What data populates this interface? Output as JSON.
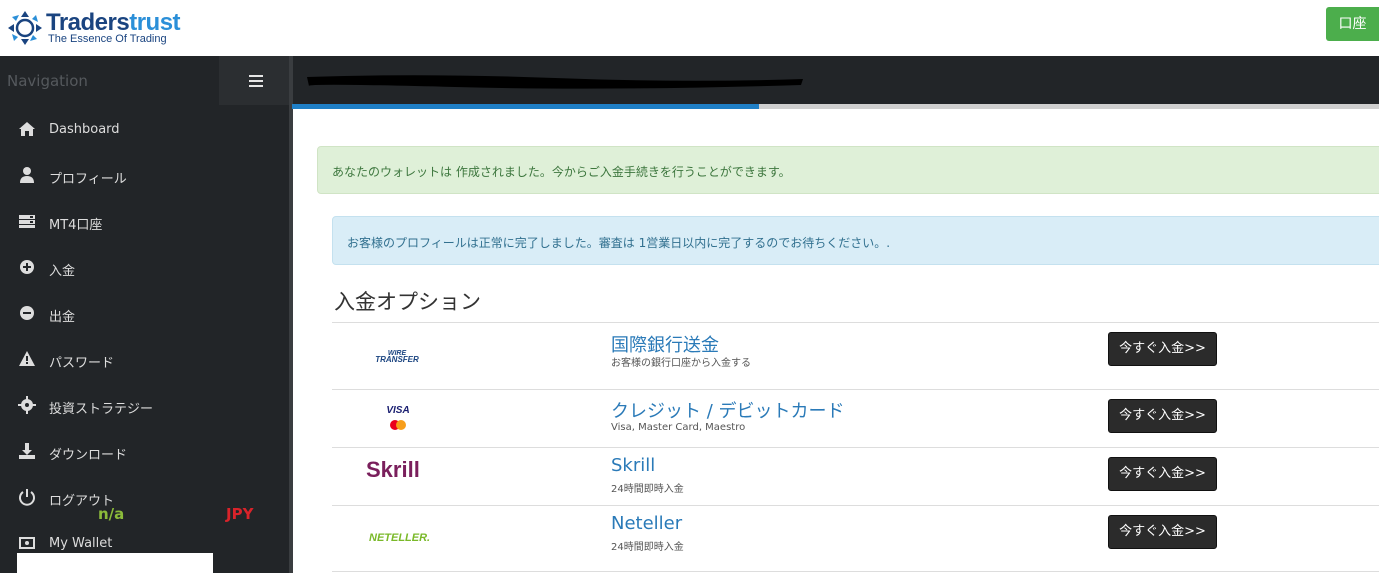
{
  "header": {
    "brand_name_part1": "Traders",
    "brand_name_part2": "trust",
    "tagline": "The Essence Of Trading",
    "account_button": "口座",
    "account_button_color": "#4cae4c"
  },
  "sidebar": {
    "title": "Navigation",
    "items": [
      {
        "label": "Dashboard",
        "icon": "home-icon"
      },
      {
        "label": "プロフィール",
        "icon": "user-icon"
      },
      {
        "label": "MT4口座",
        "icon": "server-icon"
      },
      {
        "label": "入金",
        "icon": "plus-circle-icon"
      },
      {
        "label": "出金",
        "icon": "minus-circle-icon"
      },
      {
        "label": "パスワード",
        "icon": "warning-icon"
      },
      {
        "label": "投資ストラテジー",
        "icon": "gear-icon"
      },
      {
        "label": "ダウンロード",
        "icon": "download-icon"
      },
      {
        "label": "ログアウト",
        "icon": "power-icon"
      },
      {
        "label": "My Wallet",
        "icon": "wallet-icon"
      }
    ],
    "wallet": {
      "balance": "n/a",
      "currency": "JPY"
    }
  },
  "progress": {
    "fraction": 0.43,
    "color": "#1f7fc6"
  },
  "alerts": {
    "success": "あなたのウォレットは 作成されました。今からご入金手続きを行うことができます。",
    "info": "お客様のプロフィールは正常に完了しました。審査は 1営業日以内に完了するのでお待ちください。."
  },
  "deposit": {
    "title": "入金オプション",
    "button_label": "今すぐ入金>>",
    "options": [
      {
        "name": "国際銀行送金",
        "desc": "お客様の銀行口座から入金する",
        "logo": "wire-transfer-logo",
        "logo_text": [
          "WIRE",
          "TRANSFER"
        ]
      },
      {
        "name": "クレジット / デビットカード",
        "desc": "Visa, Master Card, Maestro",
        "logo": "visa-mastercard-logo",
        "logo_text": [
          "VISA"
        ]
      },
      {
        "name": "Skrill",
        "desc": "24時間即時入金",
        "logo": "skrill-logo",
        "logo_text": [
          "Skrill"
        ]
      },
      {
        "name": "Neteller",
        "desc": "24時間即時入金",
        "logo": "neteller-logo",
        "logo_text": [
          "NETELLER."
        ]
      }
    ]
  },
  "colors": {
    "sidebar_bg": "#222528",
    "link": "#2a7ab8",
    "skrill": "#7a1f5c",
    "neteller": "#7ab929",
    "wallet_na": "#8bbb3a",
    "wallet_currency": "#d9232a"
  }
}
